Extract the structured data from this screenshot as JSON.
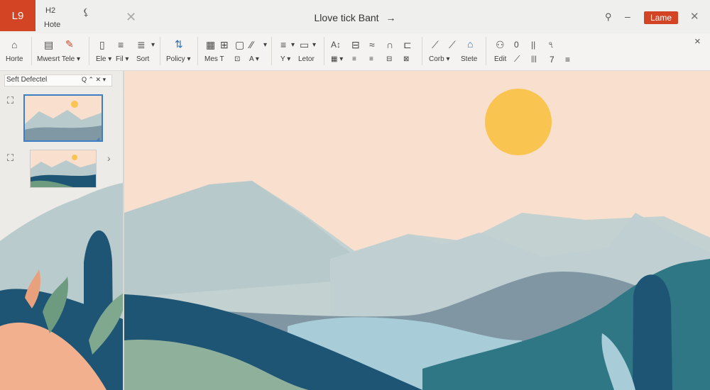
{
  "titlebar": {
    "logo": "L9",
    "tab_top": "H2",
    "tab_label": "Hote",
    "doc_title": "Llove tick Bant",
    "doc_title_arrow": "→",
    "share_label": "Lame"
  },
  "ribbon": {
    "groups": [
      {
        "id": "home",
        "icons": [
          "⌂"
        ],
        "label": "Horte"
      },
      {
        "id": "insert",
        "icons": [
          "▤",
          "✎"
        ],
        "label": "Mwesrt Tele ▾"
      },
      {
        "id": "file",
        "icons": [
          "▯",
          "≡",
          "≣"
        ],
        "labels": [
          "Ele ▾",
          "Fil ▾",
          "Sort"
        ]
      },
      {
        "id": "policy",
        "icons": [
          "⇅"
        ],
        "label": "Policy ▾"
      },
      {
        "id": "mes",
        "icons": [
          "▦",
          "⊞",
          "▢",
          "∕∕"
        ],
        "labels": [
          "Mes T",
          "⊡",
          "A ▾"
        ]
      },
      {
        "id": "letter",
        "icons": [
          "≡",
          "▭"
        ],
        "labels": [
          "Y ▾",
          "Letor"
        ]
      },
      {
        "id": "align",
        "icons": [
          "A↕",
          "⊟",
          "≈",
          "∩",
          "⊏"
        ],
        "labels": [
          "▦ ▾",
          "≡",
          "≡",
          "⊟",
          "⊠"
        ]
      },
      {
        "id": "corb",
        "icons": [
          "⟋",
          "⟋",
          "⌂"
        ],
        "labels": [
          "Corb ▾",
          "Stete"
        ]
      },
      {
        "id": "edit",
        "icons": [
          "⚇",
          "0",
          "||",
          "৭"
        ],
        "labels": [
          "Edit",
          "⟋",
          "|||",
          "7",
          "≡"
        ]
      }
    ],
    "close": "×"
  },
  "left_panel": {
    "header": "Seft Defectel",
    "header_icons": "Q ⌃ ✕  ▾",
    "expand_arrow": "›"
  },
  "colors": {
    "accent": "#d24424",
    "sky": "#f9dfcd",
    "sun": "#f9c450",
    "mountain_light": "#b8cacb",
    "hill_dark": "#1e5575",
    "hill_teal": "#2f7785"
  }
}
